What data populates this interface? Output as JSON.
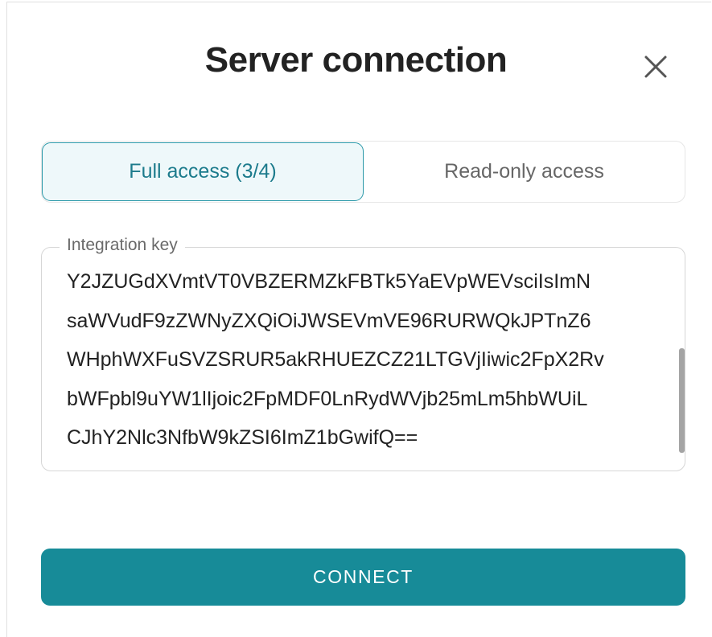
{
  "dialog": {
    "title": "Server connection",
    "close_icon": "close-icon"
  },
  "tabs": [
    {
      "label": "Full access (3/4)",
      "active": true
    },
    {
      "label": "Read-only access",
      "active": false
    }
  ],
  "integration_key": {
    "label": "Integration key",
    "value": "Y2JZUGdXVmtVT0VBZERMZkFBTk5YaEVpWEVsciIsImN\nsaWVudF9zZWNyZXQiOiJWSEVmVE96RURWQkJPTnZ6\nWHphWXFuSVZSRUR5akRHUEZCZ21LTGVjIiwic2FpX2Rv\nbWFpbl9uYW1lIjoic2FpMDF0LnRydWVjb25mLm5hbWUiL\nCJhY2Nlc3NfbW9kZSI6ImZ1bGwifQ=="
  },
  "connect_button": {
    "label": "CONNECT"
  },
  "colors": {
    "accent": "#178b98",
    "active_tab_bg": "#eef8fa",
    "active_tab_text": "#1c7b8c"
  }
}
